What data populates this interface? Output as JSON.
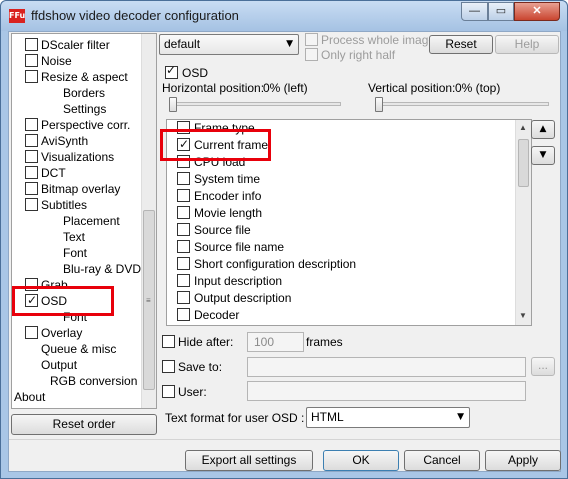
{
  "window": {
    "title": "ffdshow video decoder configuration",
    "app_icon": "FFu",
    "controls": {
      "minimize": "—",
      "maximize": "▭",
      "close": "✕"
    }
  },
  "tree": {
    "items": [
      {
        "label": "DScaler filter",
        "checkbox": true,
        "checked": false
      },
      {
        "label": "Noise",
        "checkbox": true,
        "checked": false
      },
      {
        "label": "Resize & aspect",
        "checkbox": true,
        "checked": false
      },
      {
        "label": "Borders",
        "checkbox": false
      },
      {
        "label": "Settings",
        "checkbox": false
      },
      {
        "label": "Perspective corr.",
        "checkbox": true,
        "checked": false
      },
      {
        "label": "AviSynth",
        "checkbox": true,
        "checked": false
      },
      {
        "label": "Visualizations",
        "checkbox": true,
        "checked": false
      },
      {
        "label": "DCT",
        "checkbox": true,
        "checked": false
      },
      {
        "label": "Bitmap overlay",
        "checkbox": true,
        "checked": false
      },
      {
        "label": "Subtitles",
        "checkbox": true,
        "checked": false
      },
      {
        "label": "Placement",
        "checkbox": false
      },
      {
        "label": "Text",
        "checkbox": false
      },
      {
        "label": "Font",
        "checkbox": false
      },
      {
        "label": "Blu-ray & DVD",
        "checkbox": false
      },
      {
        "label": "Grab",
        "checkbox": true,
        "checked": false
      },
      {
        "label": "OSD",
        "checkbox": true,
        "checked": true
      },
      {
        "label": "Font",
        "checkbox": false
      },
      {
        "label": "Overlay",
        "checkbox": true,
        "checked": false
      },
      {
        "label": "Queue & misc",
        "checkbox": false
      },
      {
        "label": "Output",
        "checkbox": false
      },
      {
        "label": "RGB conversion",
        "checkbox": false
      },
      {
        "label": "About",
        "checkbox": false
      }
    ],
    "reset_order_label": "Reset order"
  },
  "top": {
    "preset_value": "default",
    "process_whole_image_label": "Process whole image",
    "only_right_half_label": "Only right half",
    "reset_label": "Reset",
    "help_label": "Help"
  },
  "osd": {
    "enable_label": "OSD",
    "enabled": true,
    "horizontal_position_label": "Horizontal position:",
    "horizontal_position_value": "0% (left)",
    "vertical_position_label": "Vertical position:",
    "vertical_position_value": "0% (top)",
    "horizontal_slider_level": 0,
    "vertical_slider_level": 0,
    "items": [
      {
        "label": "Frame type",
        "checked": false
      },
      {
        "label": "Current frame",
        "checked": true
      },
      {
        "label": "CPU load",
        "checked": false
      },
      {
        "label": "System time",
        "checked": false
      },
      {
        "label": "Encoder info",
        "checked": false
      },
      {
        "label": "Movie length",
        "checked": false
      },
      {
        "label": "Source file",
        "checked": false
      },
      {
        "label": "Source file name",
        "checked": false
      },
      {
        "label": "Short configuration description",
        "checked": false
      },
      {
        "label": "Input description",
        "checked": false
      },
      {
        "label": "Output description",
        "checked": false
      },
      {
        "label": "Decoder",
        "checked": false
      }
    ],
    "move_up_icon": "▲",
    "move_down_icon": "▼",
    "hide_after_label": "Hide after:",
    "hide_after_value": "100",
    "frames_label": "frames",
    "save_to_label": "Save to:",
    "browse_label": "...",
    "user_label": "User:",
    "text_format_label": "Text format for user OSD :",
    "text_format_value": "HTML"
  },
  "footer": {
    "export_label": "Export all settings",
    "ok_label": "OK",
    "cancel_label": "Cancel",
    "apply_label": "Apply"
  },
  "highlight_color": "#e8000b"
}
